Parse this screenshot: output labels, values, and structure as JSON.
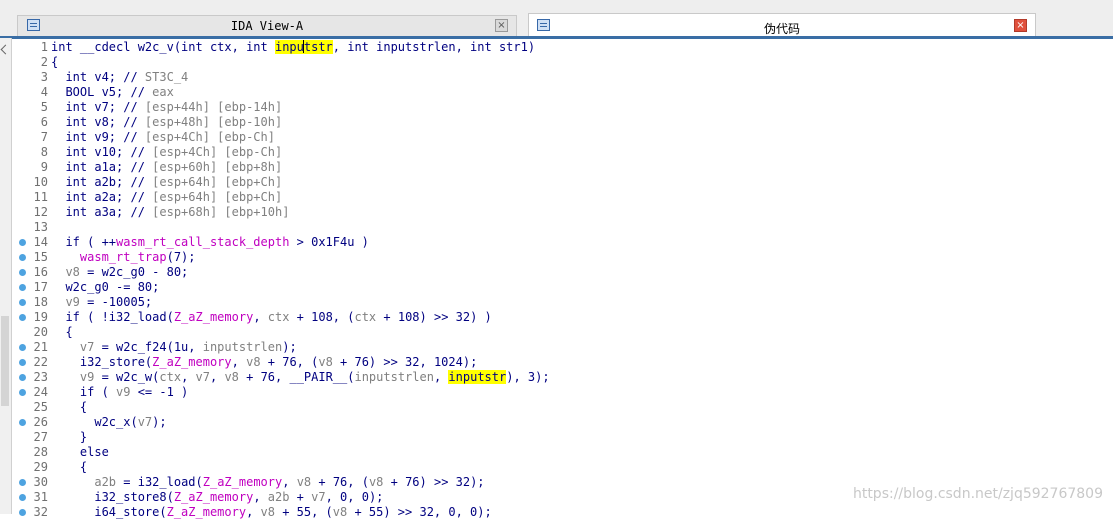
{
  "tabs": [
    {
      "label": "IDA View-A",
      "close": "×",
      "active": false,
      "icon": "view-icon"
    },
    {
      "label": "伪代码",
      "close": "×",
      "active": true,
      "icon": "view-icon"
    }
  ],
  "watermark": "https://blog.csdn.net/zjq592767809",
  "colors": {
    "keyword_text": "#000080",
    "comment": "#808080",
    "global": "#c000c0",
    "highlight": "#ffff00",
    "breakpoint_dot": "#4ea3e0"
  },
  "code": [
    {
      "num": "1",
      "dot": false,
      "parts": [
        [
          "p",
          "int __cdecl w2c_v(int ctx, int "
        ],
        [
          "h",
          "inpu"
        ],
        [
          "caret",
          ""
        ],
        [
          "h",
          "tstr"
        ],
        [
          "p",
          ", int inputstrlen, int str1)"
        ]
      ]
    },
    {
      "num": "2",
      "dot": false,
      "parts": [
        [
          "p",
          "{"
        ]
      ]
    },
    {
      "num": "3",
      "dot": false,
      "parts": [
        [
          "p",
          "  int v4; // "
        ],
        [
          "c",
          "ST3C_4"
        ]
      ]
    },
    {
      "num": "4",
      "dot": false,
      "parts": [
        [
          "p",
          "  BOOL v5; // "
        ],
        [
          "c",
          "eax"
        ]
      ]
    },
    {
      "num": "5",
      "dot": false,
      "parts": [
        [
          "p",
          "  int v7; // "
        ],
        [
          "c",
          "[esp+44h] [ebp-14h]"
        ]
      ]
    },
    {
      "num": "6",
      "dot": false,
      "parts": [
        [
          "p",
          "  int v8; // "
        ],
        [
          "c",
          "[esp+48h] [ebp-10h]"
        ]
      ]
    },
    {
      "num": "7",
      "dot": false,
      "parts": [
        [
          "p",
          "  int v9; // "
        ],
        [
          "c",
          "[esp+4Ch] [ebp-Ch]"
        ]
      ]
    },
    {
      "num": "8",
      "dot": false,
      "parts": [
        [
          "p",
          "  int v10; // "
        ],
        [
          "c",
          "[esp+4Ch] [ebp-Ch]"
        ]
      ]
    },
    {
      "num": "9",
      "dot": false,
      "parts": [
        [
          "p",
          "  int a1a; // "
        ],
        [
          "c",
          "[esp+60h] [ebp+8h]"
        ]
      ]
    },
    {
      "num": "10",
      "dot": false,
      "parts": [
        [
          "p",
          "  int a2b; // "
        ],
        [
          "c",
          "[esp+64h] [ebp+Ch]"
        ]
      ]
    },
    {
      "num": "11",
      "dot": false,
      "parts": [
        [
          "p",
          "  int a2a; // "
        ],
        [
          "c",
          "[esp+64h] [ebp+Ch]"
        ]
      ]
    },
    {
      "num": "12",
      "dot": false,
      "parts": [
        [
          "p",
          "  int a3a; // "
        ],
        [
          "c",
          "[esp+68h] [ebp+10h]"
        ]
      ]
    },
    {
      "num": "13",
      "dot": false,
      "parts": [
        [
          "p",
          ""
        ]
      ]
    },
    {
      "num": "14",
      "dot": true,
      "parts": [
        [
          "p",
          "  if ( ++"
        ],
        [
          "g",
          "wasm_rt_call_stack_depth"
        ],
        [
          "p",
          " > 0x1F4u )"
        ]
      ]
    },
    {
      "num": "15",
      "dot": true,
      "parts": [
        [
          "p",
          "    "
        ],
        [
          "g",
          "wasm_rt_trap"
        ],
        [
          "p",
          "(7);"
        ]
      ]
    },
    {
      "num": "16",
      "dot": true,
      "parts": [
        [
          "p",
          "  "
        ],
        [
          "v",
          "v8"
        ],
        [
          "p",
          " = w2c_g0 - 80;"
        ]
      ]
    },
    {
      "num": "17",
      "dot": true,
      "parts": [
        [
          "p",
          "  w2c_g0 -= 80;"
        ]
      ]
    },
    {
      "num": "18",
      "dot": true,
      "parts": [
        [
          "p",
          "  "
        ],
        [
          "v",
          "v9"
        ],
        [
          "p",
          " = -10005;"
        ]
      ]
    },
    {
      "num": "19",
      "dot": true,
      "parts": [
        [
          "p",
          "  if ( !i32_load("
        ],
        [
          "g",
          "Z_aZ_memory"
        ],
        [
          "p",
          ", "
        ],
        [
          "v",
          "ctx"
        ],
        [
          "p",
          " + 108, ("
        ],
        [
          "v",
          "ctx"
        ],
        [
          "p",
          " + 108) >> 32) )"
        ]
      ]
    },
    {
      "num": "20",
      "dot": false,
      "parts": [
        [
          "p",
          "  {"
        ]
      ]
    },
    {
      "num": "21",
      "dot": true,
      "parts": [
        [
          "p",
          "    "
        ],
        [
          "v",
          "v7"
        ],
        [
          "p",
          " = w2c_f24(1u, "
        ],
        [
          "v",
          "inputstrlen"
        ],
        [
          "p",
          ");"
        ]
      ]
    },
    {
      "num": "22",
      "dot": true,
      "parts": [
        [
          "p",
          "    i32_store("
        ],
        [
          "g",
          "Z_aZ_memory"
        ],
        [
          "p",
          ", "
        ],
        [
          "v",
          "v8"
        ],
        [
          "p",
          " + 76, ("
        ],
        [
          "v",
          "v8"
        ],
        [
          "p",
          " + 76) >> 32, 1024);"
        ]
      ]
    },
    {
      "num": "23",
      "dot": true,
      "parts": [
        [
          "p",
          "    "
        ],
        [
          "v",
          "v9"
        ],
        [
          "p",
          " = w2c_w("
        ],
        [
          "v",
          "ctx"
        ],
        [
          "p",
          ", "
        ],
        [
          "v",
          "v7"
        ],
        [
          "p",
          ", "
        ],
        [
          "v",
          "v8"
        ],
        [
          "p",
          " + 76, __PAIR__("
        ],
        [
          "v",
          "inputstrlen"
        ],
        [
          "p",
          ", "
        ],
        [
          "h",
          "inputstr"
        ],
        [
          "p",
          "), 3);"
        ]
      ]
    },
    {
      "num": "24",
      "dot": true,
      "parts": [
        [
          "p",
          "    if ( "
        ],
        [
          "v",
          "v9"
        ],
        [
          "p",
          " <= -1 )"
        ]
      ]
    },
    {
      "num": "25",
      "dot": false,
      "parts": [
        [
          "p",
          "    {"
        ]
      ]
    },
    {
      "num": "26",
      "dot": true,
      "parts": [
        [
          "p",
          "      w2c_x("
        ],
        [
          "v",
          "v7"
        ],
        [
          "p",
          ");"
        ]
      ]
    },
    {
      "num": "27",
      "dot": false,
      "parts": [
        [
          "p",
          "    }"
        ]
      ]
    },
    {
      "num": "28",
      "dot": false,
      "parts": [
        [
          "p",
          "    else"
        ]
      ]
    },
    {
      "num": "29",
      "dot": false,
      "parts": [
        [
          "p",
          "    {"
        ]
      ]
    },
    {
      "num": "30",
      "dot": true,
      "parts": [
        [
          "p",
          "      "
        ],
        [
          "v",
          "a2b"
        ],
        [
          "p",
          " = i32_load("
        ],
        [
          "g",
          "Z_aZ_memory"
        ],
        [
          "p",
          ", "
        ],
        [
          "v",
          "v8"
        ],
        [
          "p",
          " + 76, ("
        ],
        [
          "v",
          "v8"
        ],
        [
          "p",
          " + 76) >> 32);"
        ]
      ]
    },
    {
      "num": "31",
      "dot": true,
      "parts": [
        [
          "p",
          "      i32_store8("
        ],
        [
          "g",
          "Z_aZ_memory"
        ],
        [
          "p",
          ", "
        ],
        [
          "v",
          "a2b"
        ],
        [
          "p",
          " + "
        ],
        [
          "v",
          "v7"
        ],
        [
          "p",
          ", 0, 0);"
        ]
      ]
    },
    {
      "num": "32",
      "dot": true,
      "parts": [
        [
          "p",
          "      i64_store("
        ],
        [
          "g",
          "Z_aZ_memory"
        ],
        [
          "p",
          ", "
        ],
        [
          "v",
          "v8"
        ],
        [
          "p",
          " + 55, ("
        ],
        [
          "v",
          "v8"
        ],
        [
          "p",
          " + 55) >> 32, 0, 0);"
        ]
      ]
    }
  ]
}
